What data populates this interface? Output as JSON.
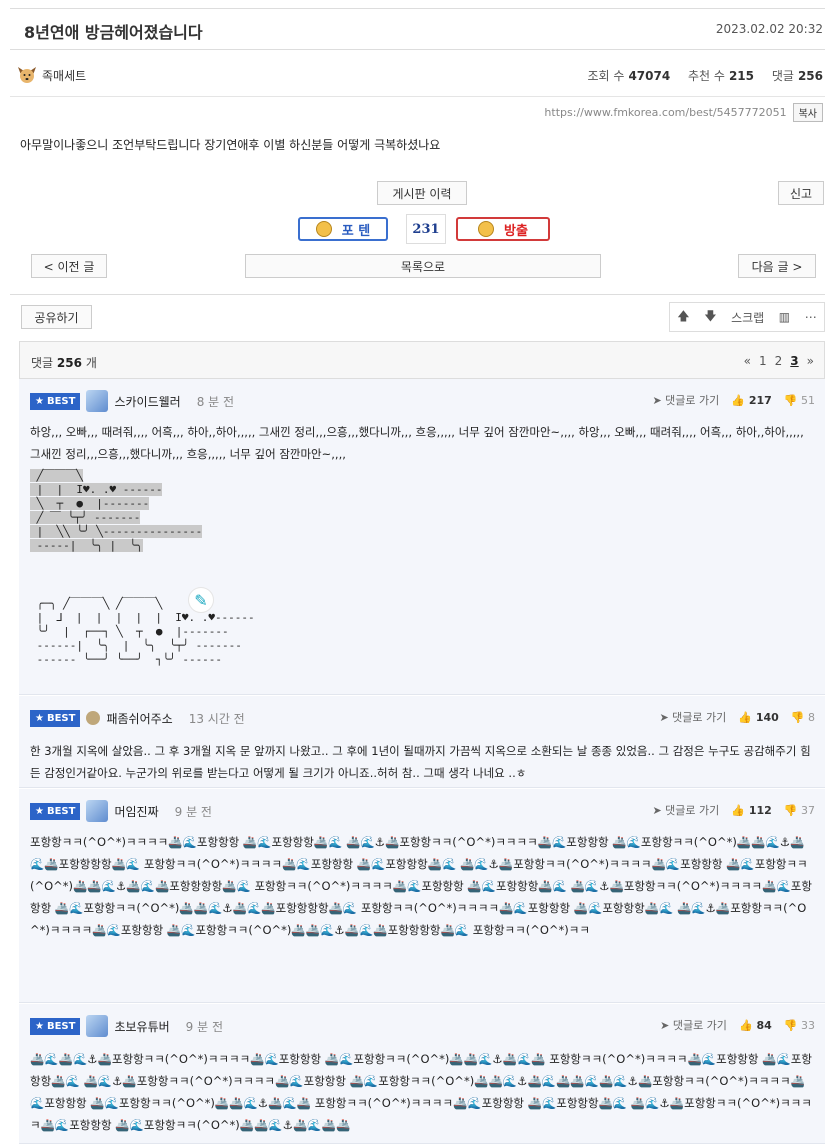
{
  "post": {
    "title": "8년연애 방금헤어졌습니다",
    "date": "2023.02.02 20:32",
    "author": "족매세트",
    "views_label": "조회 수",
    "views": "47074",
    "recommend_label": "추천 수",
    "recommend": "215",
    "comments_label": "댓글",
    "comments": "256",
    "url": "https://www.fmkorea.com/best/5457772051",
    "copy_label": "복사",
    "body": "아무말이나좋으니 조언부탁드립니다  장기연애후 이별 하신분들 어떻게 극복하셨나요"
  },
  "buttons": {
    "history": "게시판 이력",
    "report": "신고",
    "positive": "포 텐",
    "vote_count": "231",
    "negative": "방출",
    "prev": "< 이전 글",
    "list": "목록으로",
    "next": "다음 글 >",
    "share": "공유하기",
    "scrap": "스크랩"
  },
  "comment_header": {
    "label": "댓글",
    "count": "256",
    "unit": "개",
    "pages": [
      "«",
      "1",
      "2",
      "3",
      "»"
    ],
    "current_page": "3"
  },
  "comments": [
    {
      "badge": "BEST",
      "nick": "스카이드웰러",
      "time": "8 분 전",
      "reply": "댓글로 가기",
      "up": "217",
      "down": "51",
      "text": "하앙,,, 오빠,,, 때려줘,,,, 어흑,,, 하아,,하아,,,,, 그새낀 정리,,,으흥,,,했다니까,,, 흐응,,,,, 너무 깊어 잠깐마안~,,,, 하앙,,, 오빠,,, 때려줘,,,, 어흑,,, 하아,,하아,,,,, 그새낀 정리,,,으흥,,,했다니까,,, 흐응,,,,, 너무 깊어 잠깐마안~,,,,"
    },
    {
      "badge": "BEST",
      "nick": "패좀쉬어주소",
      "time": "13 시간 전",
      "reply": "댓글로 가기",
      "up": "140",
      "down": "8",
      "text": "한 3개월 지옥에 살았음.. 그 후 3개월 지옥 문 앞까지 나왔고.. 그 후에 1년이 될때까지 가끔씩 지옥으로 소환되는 날 종종 있었음.. 그 감정은 누구도 공감해주기 힘든 감정인거같아요. 누군가의 위로를 받는다고 어떻게 될 크기가 아니죠..허허 참.. 그때 생각 나네요 ..ㅎ"
    },
    {
      "badge": "BEST",
      "nick": "머임진짜",
      "time": "9 분 전",
      "reply": "댓글로 가기",
      "up": "112",
      "down": "37",
      "text": "포항항ㅋㅋ(^O^*)ㅋㅋㅋㅋ🚢🌊포항항항 🚢🌊포항항항🚢🌊 🚢🌊⚓🚢포항항ㅋㅋ(^O^*)ㅋㅋㅋㅋ🚢🌊포항항항 🚢🌊포항항ㅋㅋ(^O^*)🚢🚢🌊⚓🚢🌊🚢포항항항항🚢🌊 포항항ㅋㅋ(^O^*)ㅋㅋㅋㅋ🚢🌊포항항항 🚢🌊포항항항🚢🌊 🚢🌊⚓🚢포항항ㅋㅋ(^O^*)ㅋㅋㅋㅋ🚢🌊포항항항 🚢🌊포항항ㅋㅋ(^O^*)🚢🚢🌊⚓🚢🌊🚢포항항항항🚢🌊 포항항ㅋㅋ(^O^*)ㅋㅋㅋㅋ🚢🌊포항항항 🚢🌊포항항항🚢🌊 🚢🌊⚓🚢포항항ㅋㅋ(^O^*)ㅋㅋㅋㅋ🚢🌊포항항항 🚢🌊포항항ㅋㅋ(^O^*)🚢🚢🌊⚓🚢🌊🚢포항항항항🚢🌊 포항항ㅋㅋ(^O^*)ㅋㅋㅋㅋ🚢🌊포항항항 🚢🌊포항항항🚢🌊 🚢🌊⚓🚢포항항ㅋㅋ(^O^*)ㅋㅋㅋㅋ🚢🌊포항항항 🚢🌊포항항ㅋㅋ(^O^*)🚢🚢🌊⚓🚢🌊🚢포항항항항🚢🌊 포항항ㅋㅋ(^O^*)ㅋㅋ"
    },
    {
      "badge": "BEST",
      "nick": "초보유튜버",
      "time": "9 분 전",
      "reply": "댓글로 가기",
      "up": "84",
      "down": "33",
      "text": "🚢🌊🚢🌊⚓🚢포항항ㅋㅋ(^O^*)ㅋㅋㅋㅋ🚢🌊포항항항 🚢🌊포항항ㅋㅋ(^O^*)🚢🚢🌊⚓🚢🌊🚢 포항항ㅋㅋ(^O^*)ㅋㅋㅋㅋ🚢🌊포항항항 🚢🌊포항항항🚢🌊 🚢🌊⚓🚢포항항ㅋㅋ(^O^*)ㅋㅋㅋㅋ🚢🌊포항항항 🚢🌊포항항ㅋㅋ(^O^*)🚢🚢🌊⚓🚢🌊🚢🚢🌊🚢🌊⚓🚢포항항ㅋㅋ(^O^*)ㅋㅋㅋㅋ🚢🌊포항항항 🚢🌊포항항ㅋㅋ(^O^*)🚢🚢🌊⚓🚢🌊🚢 포항항ㅋㅋ(^O^*)ㅋㅋㅋㅋ🚢🌊포항항항 🚢🌊포항항항🚢🌊 🚢🌊⚓🚢포항항ㅋㅋ(^O^*)ㅋㅋㅋㅋ🚢🌊포항항항 🚢🌊포항항ㅋㅋ(^O^*)🚢🚢🌊⚓🚢🌊🚢🚢"
    }
  ],
  "ascii_art": {
    "block1": " ╱￣￣￣╲\n |  |  I♥. .♥ ------\n ╲  ┬  ●  |-------\n ╱ ￣ ╰┬╯ -------\n |  ╲╲ ╰╯ ╲---------------\n -----|  ╰╮ |  ╰╮",
    "block2": " ╭─╮ ╱￣￣￣╲ ╱￣￣￣╲\n |  ⅃  |  |  |  |  |  I♥. .♥------\n ╰╯  |  ┌──┐ ╲  ┬  ●  |-------\n ------|  ╰╮  |  ╰╮  ╰┬╯ -------\n ------ ╰──╯ ╰──╯  ┐╰╯ ------"
  }
}
